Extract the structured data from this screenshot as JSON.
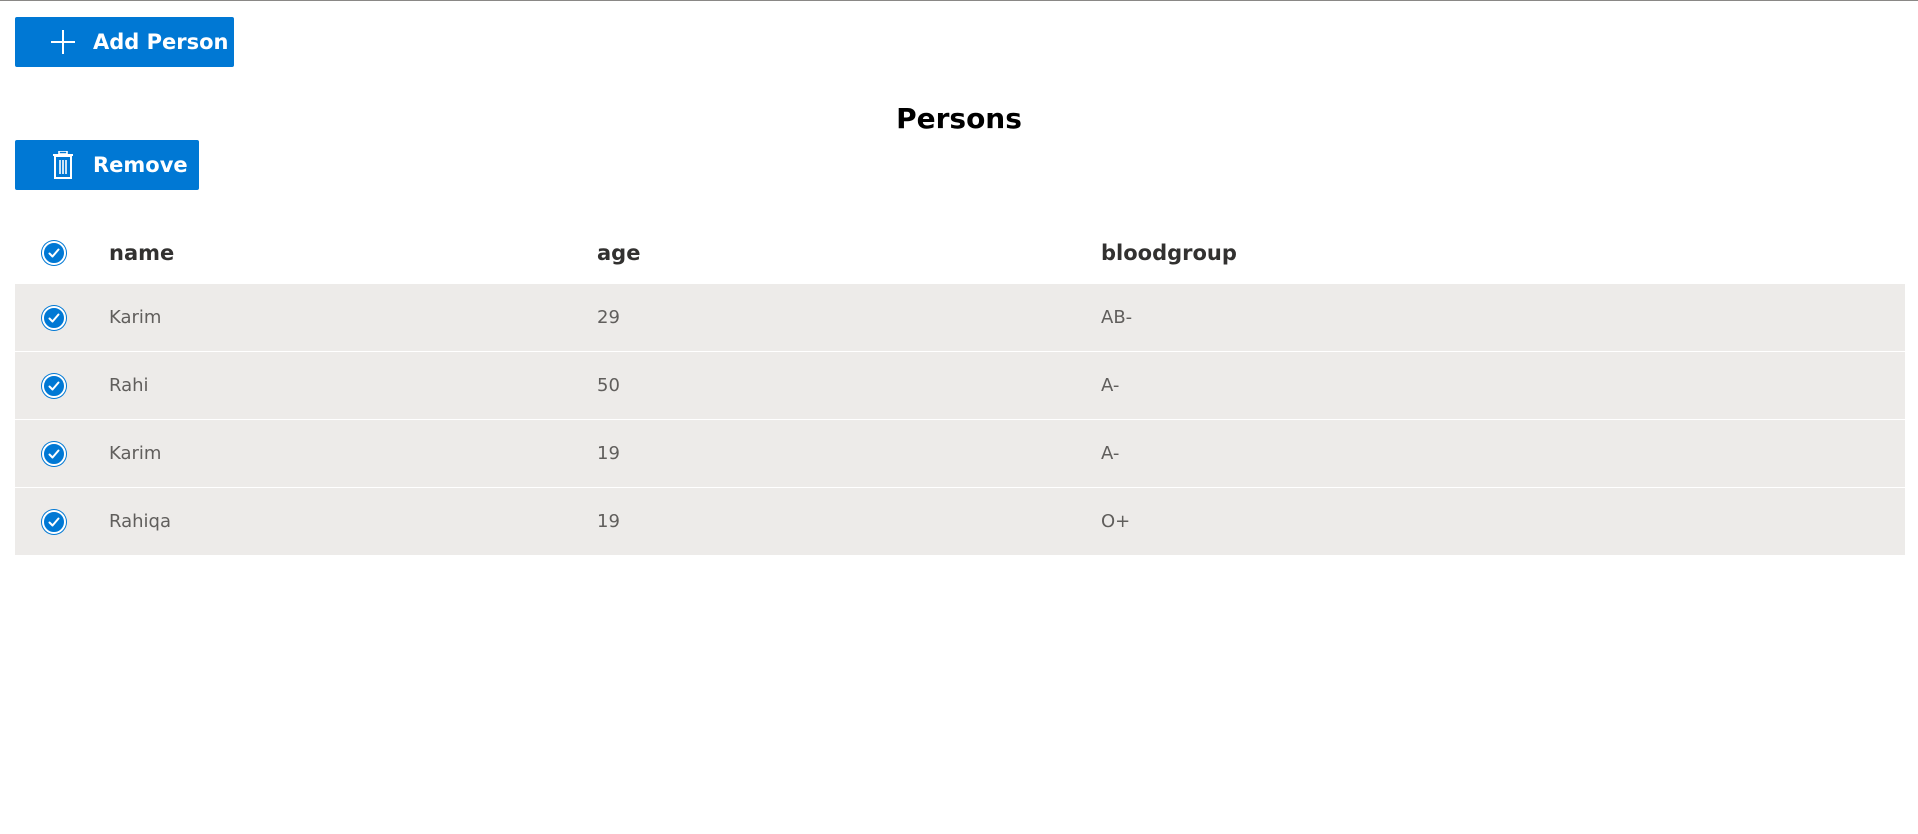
{
  "toolbar": {
    "add_label": "Add Person",
    "remove_label": "Remove"
  },
  "page": {
    "title": "Persons"
  },
  "colors": {
    "accent": "#0078d4",
    "row_background": "#edebe9"
  },
  "icons": {
    "add": "plus-icon",
    "remove": "trash-icon",
    "check": "checkmark-icon"
  },
  "table": {
    "columns": [
      "name",
      "age",
      "bloodgroup"
    ],
    "all_selected": true,
    "rows": [
      {
        "name": "Karim",
        "age": "29",
        "bloodgroup": "AB-",
        "selected": true
      },
      {
        "name": "Rahi",
        "age": "50",
        "bloodgroup": "A-",
        "selected": true
      },
      {
        "name": "Karim",
        "age": "19",
        "bloodgroup": "A-",
        "selected": true
      },
      {
        "name": "Rahiqa",
        "age": "19",
        "bloodgroup": "O+",
        "selected": true
      }
    ]
  }
}
